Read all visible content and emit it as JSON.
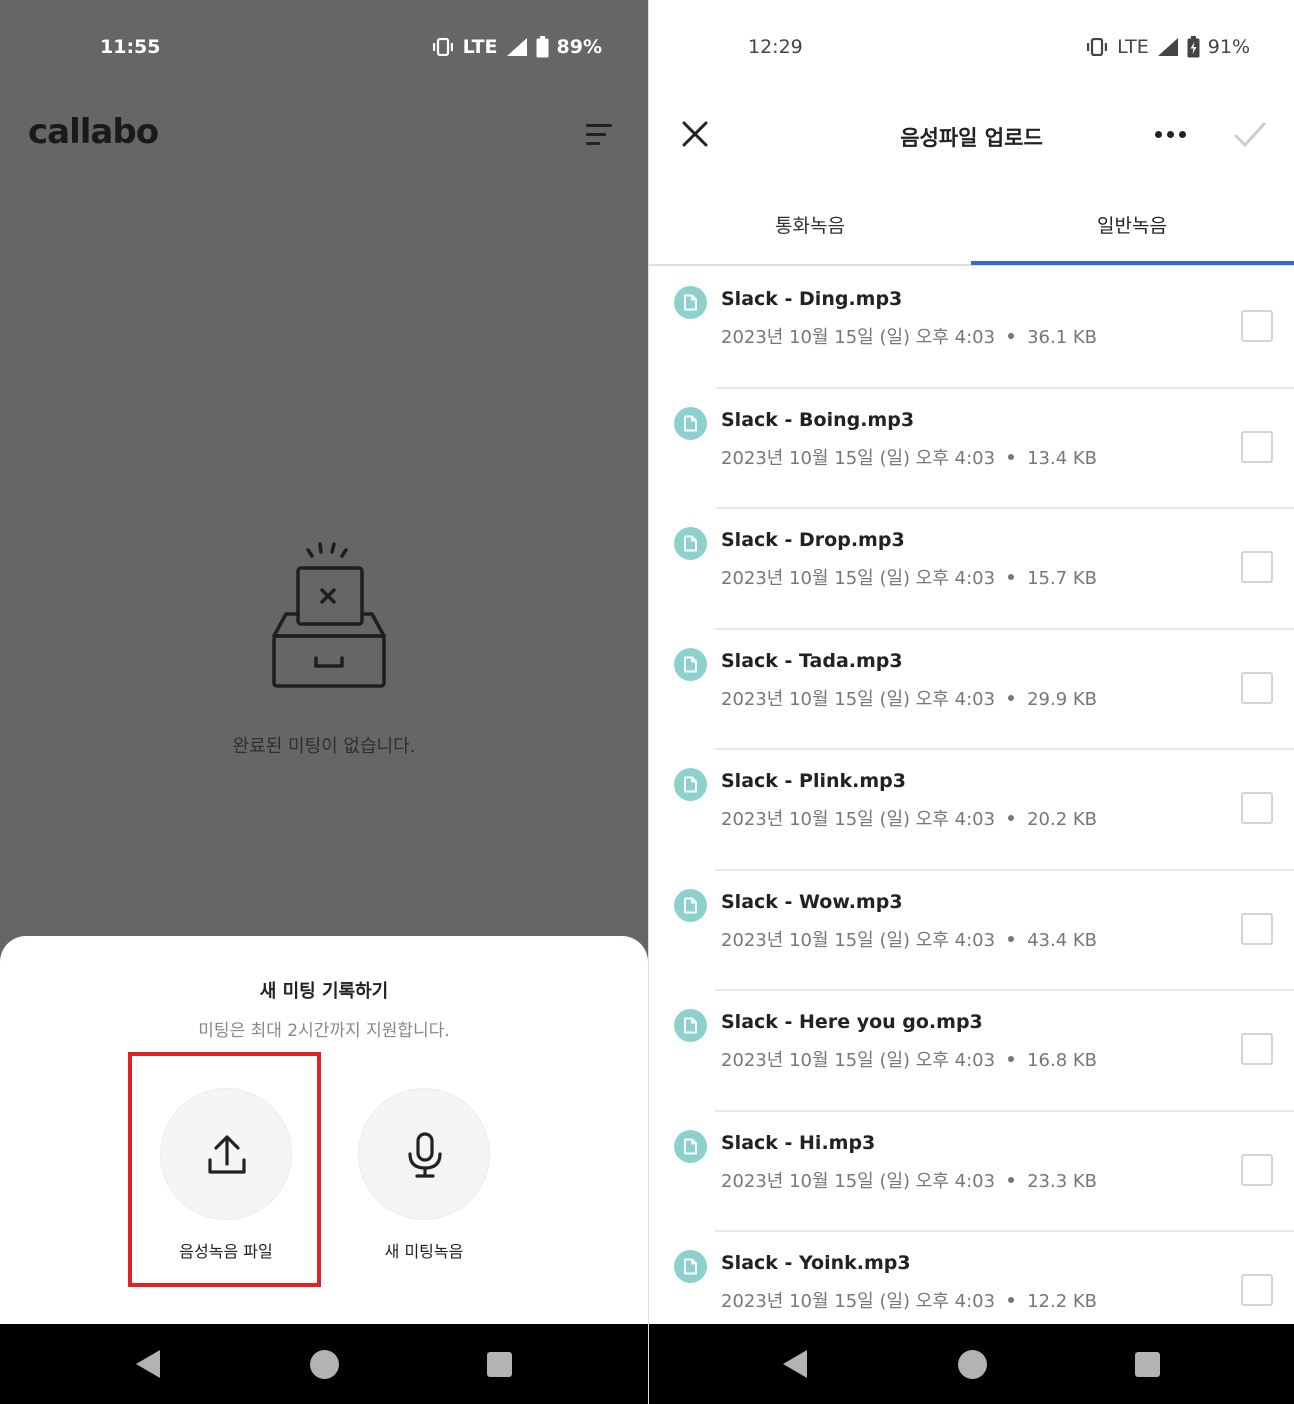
{
  "left_screen": {
    "status_bar": {
      "time": "11:55",
      "network": "LTE",
      "battery": "89%"
    },
    "app_logo": "callabo",
    "empty_state_text": "완료된 미팅이 없습니다.",
    "bottom_sheet": {
      "title": "새 미팅 기록하기",
      "subtitle": "미팅은 최대 2시간까지 지원합니다.",
      "options": [
        {
          "label": "음성녹음 파일",
          "icon": "upload-icon",
          "highlighted": true
        },
        {
          "label": "새 미팅녹음",
          "icon": "microphone-icon",
          "highlighted": false
        }
      ]
    }
  },
  "right_screen": {
    "status_bar": {
      "time": "12:29",
      "network": "LTE",
      "battery": "91%"
    },
    "header": {
      "title": "음성파일 업로드",
      "close_icon": "close-icon",
      "more_icon": "more-icon",
      "confirm_icon": "check-icon"
    },
    "tabs": [
      {
        "label": "통화녹음",
        "active": false
      },
      {
        "label": "일반녹음",
        "active": true
      }
    ],
    "files": [
      {
        "name": "Slack - Ding.mp3",
        "date": "2023년 10월 15일 (일) 오후 4:03",
        "size": "36.1 KB",
        "checked": false
      },
      {
        "name": "Slack - Boing.mp3",
        "date": "2023년 10월 15일 (일) 오후 4:03",
        "size": "13.4 KB",
        "checked": false
      },
      {
        "name": "Slack - Drop.mp3",
        "date": "2023년 10월 15일 (일) 오후 4:03",
        "size": "15.7 KB",
        "checked": false
      },
      {
        "name": "Slack - Tada.mp3",
        "date": "2023년 10월 15일 (일) 오후 4:03",
        "size": "29.9 KB",
        "checked": false
      },
      {
        "name": "Slack - Plink.mp3",
        "date": "2023년 10월 15일 (일) 오후 4:03",
        "size": "20.2 KB",
        "checked": false
      },
      {
        "name": "Slack - Wow.mp3",
        "date": "2023년 10월 15일 (일) 오후 4:03",
        "size": "43.4 KB",
        "checked": false
      },
      {
        "name": "Slack - Here you go.mp3",
        "date": "2023년 10월 15일 (일) 오후 4:03",
        "size": "16.8 KB",
        "checked": false
      },
      {
        "name": "Slack - Hi.mp3",
        "date": "2023년 10월 15일 (일) 오후 4:03",
        "size": "23.3 KB",
        "checked": false
      },
      {
        "name": "Slack - Yoink.mp3",
        "date": "2023년 10월 15일 (일) 오후 4:03",
        "size": "12.2 KB",
        "checked": false
      }
    ]
  },
  "colors": {
    "accent": "#3568d4",
    "file_icon": "#8cd1ce",
    "highlight_box": "#e02424",
    "dim_overlay": "#666666"
  }
}
